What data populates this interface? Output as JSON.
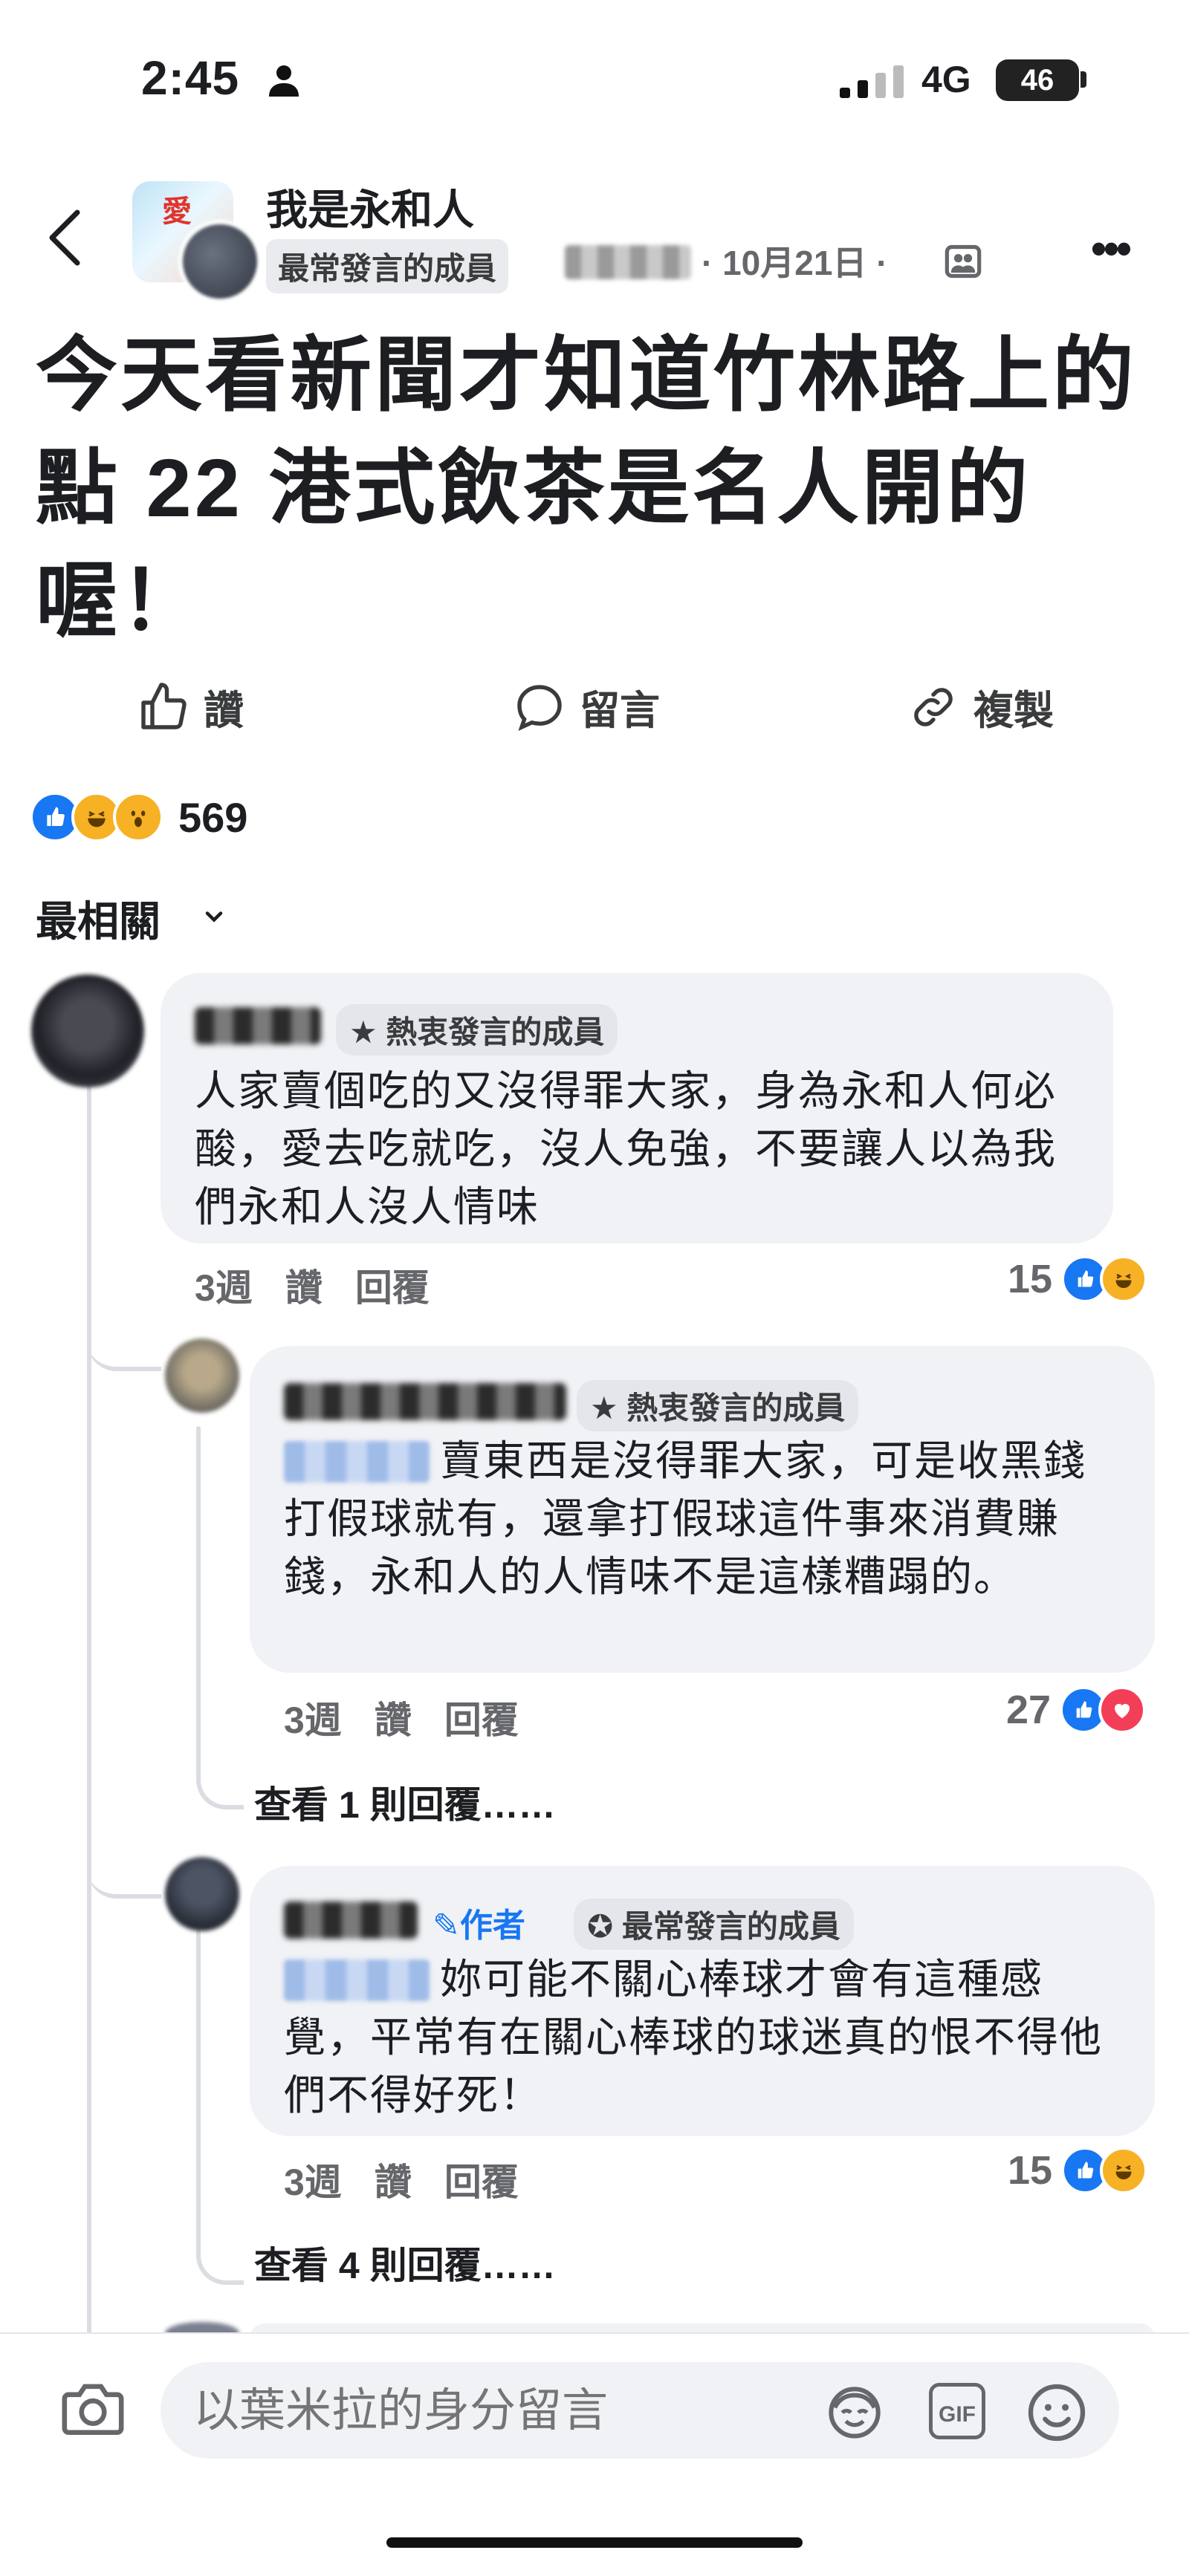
{
  "status_bar": {
    "time": "2:45",
    "network": "4G",
    "battery": "46"
  },
  "header": {
    "group_name": "我是永和人",
    "member_badge": "最常發言的成員",
    "meta": "· 10月21日 ·",
    "avatar_text": "愛"
  },
  "post": {
    "title": "今天看新聞才知道竹林路上的點 22 港式飲茶是名人開的喔！"
  },
  "actions": {
    "like": "讚",
    "comment": "留言",
    "copy": "複製"
  },
  "reactions": {
    "count": "569"
  },
  "sort": {
    "label": "最相關"
  },
  "comments": [
    {
      "badge": "熱衷發言的成員",
      "text": "人家賣個吃的又沒得罪大家，身為永和人何必酸，愛去吃就吃，沒人免強，不要讓人以為我們永和人沒人情味",
      "time": "3週",
      "like": "讚",
      "reply": "回覆",
      "reaction_count": "15"
    },
    {
      "badge": "熱衷發言的成員",
      "text": "賣東西是沒得罪大家，可是收黑錢打假球就有，還拿打假球這件事來消費賺錢，永和人的人情味不是這樣糟蹋的。",
      "time": "3週",
      "like": "讚",
      "reply": "回覆",
      "reaction_count": "27",
      "view_replies": "查看 1 則回覆……"
    },
    {
      "author_badge": "作者",
      "badge": "最常發言的成員",
      "text": "妳可能不關心棒球才會有這種感覺，平常有在關心棒球的球迷真的恨不得他們不得好死！",
      "time": "3週",
      "like": "讚",
      "reply": "回覆",
      "reaction_count": "15",
      "view_replies": "查看 4 則回覆……"
    }
  ],
  "composer": {
    "placeholder": "以葉米拉的身分留言",
    "gif": "GIF"
  }
}
